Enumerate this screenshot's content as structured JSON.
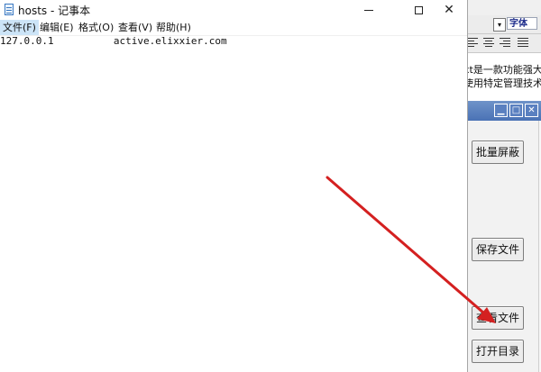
{
  "colors": {
    "arrow": "#d42020",
    "menu_highlight": "#cce4f7",
    "titlebar_blue": "#4a72b5"
  },
  "notepad": {
    "title": "hosts - 记事本",
    "icon": "notepad-icon",
    "menu": [
      "文件(F)",
      "编辑(E)",
      "格式(O)",
      "查看(V)",
      "帮助(H)"
    ],
    "content": "127.0.0.1          active.elixxier.com",
    "controls": {
      "minimize": "minimize-icon",
      "maximize": "maximize-icon",
      "close": "✕"
    }
  },
  "background_app": {
    "font_label": "字体",
    "dropdown": "▾",
    "text_lines": [
      "xt是一款功能强大",
      "使用特定管理技术"
    ],
    "tool_window": {
      "controls": [
        "▁",
        "□",
        "✕"
      ],
      "buttons": [
        "批量屏蔽",
        "保存文件",
        "查看文件",
        "打开目录"
      ]
    }
  }
}
